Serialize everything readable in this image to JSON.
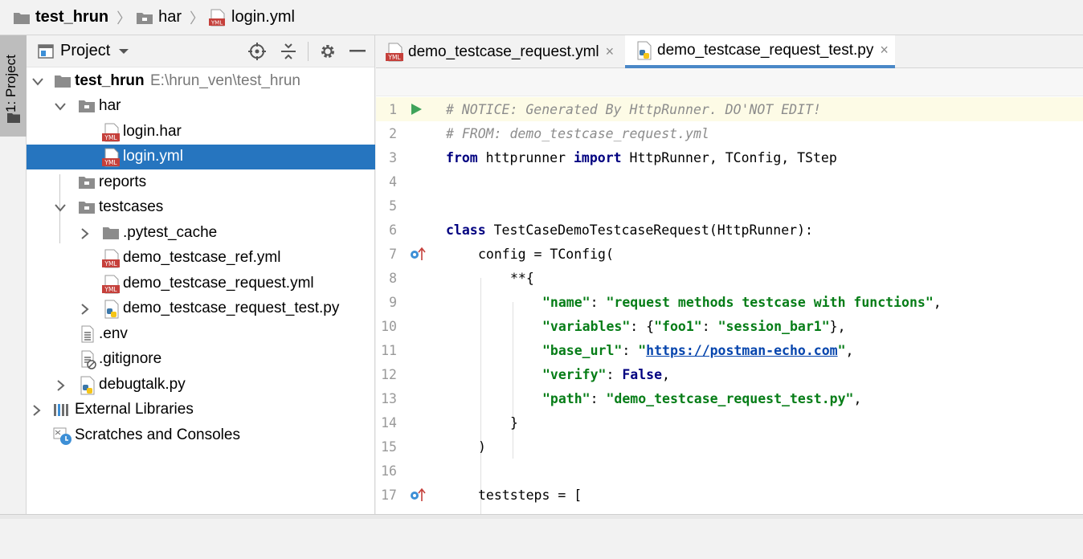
{
  "breadcrumb": {
    "root": "test_hrun",
    "folder": "har",
    "file": "login.yml"
  },
  "strip": {
    "label": "1: Project"
  },
  "project_panel": {
    "title": "Project",
    "tree": [
      {
        "label": "test_hrun",
        "detail": "E:\\hrun_ven\\test_hrun",
        "icon": "folder-icon"
      },
      {
        "label": "har",
        "icon": "folder-icon"
      },
      {
        "label": "login.har",
        "icon": "yml-file-icon"
      },
      {
        "label": "login.yml",
        "icon": "yml-file-icon",
        "selected": true
      },
      {
        "label": "reports",
        "icon": "folder-icon"
      },
      {
        "label": "testcases",
        "icon": "folder-icon"
      },
      {
        "label": ".pytest_cache",
        "icon": "folder-icon"
      },
      {
        "label": "demo_testcase_ref.yml",
        "icon": "yml-file-icon"
      },
      {
        "label": "demo_testcase_request.yml",
        "icon": "yml-file-icon"
      },
      {
        "label": "demo_testcase_request_test.py",
        "icon": "python-file-icon"
      },
      {
        "label": ".env",
        "icon": "text-file-icon"
      },
      {
        "label": ".gitignore",
        "icon": "ignore-file-icon"
      },
      {
        "label": "debugtalk.py",
        "icon": "python-file-icon"
      },
      {
        "label": "External Libraries",
        "icon": "library-icon"
      },
      {
        "label": "Scratches and Consoles",
        "icon": "scratches-icon"
      }
    ]
  },
  "editor": {
    "tabs": [
      {
        "label": "demo_testcase_request.yml",
        "close": "×"
      },
      {
        "label": "demo_testcase_request_test.py",
        "close": "×",
        "active": true
      }
    ],
    "line_numbers": [
      "1",
      "2",
      "3",
      "4",
      "5",
      "6",
      "7",
      "8",
      "9",
      "10",
      "11",
      "12",
      "13",
      "14",
      "15",
      "16",
      "17"
    ],
    "code": {
      "l1": "# NOTICE: Generated By HttpRunner. DO'NOT EDIT!",
      "l2": "# FROM: demo_testcase_request.yml",
      "l3_from": "from",
      "l3_mod": " httprunner ",
      "l3_import": "import",
      "l3_rest": " HttpRunner, TConfig, TStep",
      "l6_class": "class",
      "l6_name": " TestCaseDemoTestcaseRequest(HttpRunner):",
      "l7": "config = TConfig(",
      "l8": "**{",
      "l9_key": "\"name\"",
      "l9_val": "\"request methods testcase with functions\"",
      "l10_key": "\"variables\"",
      "l10_k2": "\"foo1\"",
      "l10_v2": "\"session_bar1\"",
      "l11_key": "\"base_url\"",
      "l11_val": "https://postman-echo.com",
      "l12_key": "\"verify\"",
      "l12_val": "False",
      "l13_key": "\"path\"",
      "l13_val": "\"demo_testcase_request_test.py\"",
      "l14": "}",
      "l15": ")",
      "l17": "teststeps = ["
    }
  }
}
